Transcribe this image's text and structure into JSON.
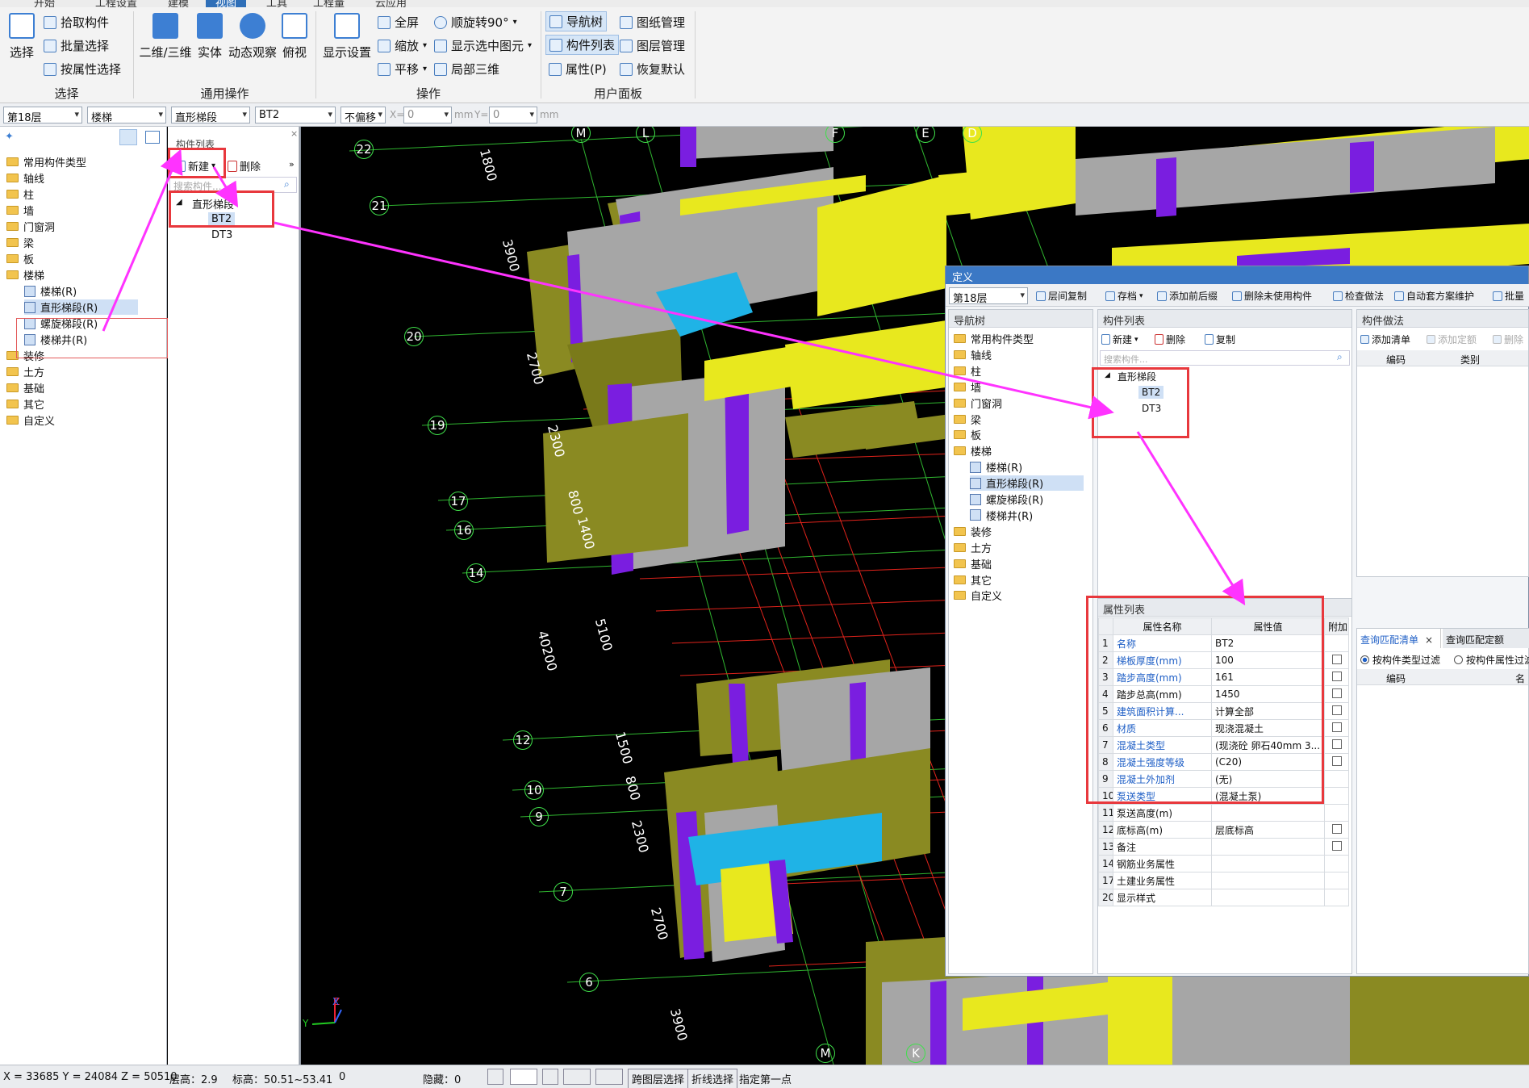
{
  "ribbon": {
    "tabs": [
      "开始",
      "工程设置",
      "建模",
      "视图",
      "工具",
      "工程量",
      "云应用"
    ],
    "active_tab": "视图",
    "select_group": {
      "big": "选择",
      "items": [
        "拾取构件",
        "批量选择",
        "按属性选择"
      ],
      "label": "选择"
    },
    "general_group": {
      "items": [
        "二维/三维",
        "实体",
        "动态观察",
        "俯视"
      ],
      "label": "通用操作"
    },
    "ops_group": {
      "display": "显示设置",
      "items": [
        "全屏",
        "缩放",
        "平移",
        "顺旋转90°",
        "显示选中图元",
        "局部三维"
      ],
      "label": "操作"
    },
    "panel_group": {
      "items": [
        "导航树",
        "构件列表",
        "属性(P)",
        "图纸管理",
        "图层管理",
        "恢复默认"
      ],
      "label": "用户面板"
    }
  },
  "toolbar": {
    "floor": "第18层",
    "category": "楼梯",
    "type": "直形梯段",
    "component": "BT2",
    "offset": "不偏移",
    "x_label": "X=",
    "x_value": "0",
    "y_label": "Y=",
    "y_value": "0",
    "unit": "mm"
  },
  "nav_tree": {
    "items": [
      "常用构件类型",
      "轴线",
      "柱",
      "墙",
      "门窗洞",
      "梁",
      "板",
      "楼梯",
      "楼梯(R)",
      "直形梯段(R)",
      "螺旋梯段(R)",
      "楼梯井(R)",
      "装修",
      "土方",
      "基础",
      "其它",
      "自定义"
    ]
  },
  "comp_list": {
    "title": "构件列表",
    "new": "新建",
    "delete": "删除",
    "search_placeholder": "搜索构件...",
    "group": "直形梯段",
    "items": [
      "BT2",
      "DT3"
    ]
  },
  "viewport": {
    "axis_top": [
      "M",
      "L",
      "F",
      "E",
      "D"
    ],
    "axis_bottom": [
      "M",
      "K"
    ],
    "rows": [
      "22",
      "21",
      "20",
      "19",
      "17",
      "16",
      "14",
      "12",
      "10",
      "9",
      "7",
      "6"
    ],
    "dims": [
      "1800",
      "3900",
      "2700",
      "2300",
      "800",
      "1400",
      "40200",
      "5100",
      "1500",
      "800",
      "2300",
      "2700",
      "3900"
    ]
  },
  "dialog": {
    "title": "定义",
    "floor": "第18层",
    "toolbar": [
      "层间复制",
      "存档",
      "添加前后缀",
      "删除未使用构件",
      "检查做法",
      "自动套方案维护",
      "批量"
    ],
    "nav_title": "导航树",
    "list_title": "构件列表",
    "list_new": "新建",
    "list_delete": "删除",
    "list_copy": "复制",
    "list_search": "搜索构件...",
    "list_group": "直形梯段",
    "list_items": [
      "BT2",
      "DT3"
    ],
    "method_title": "构件做法",
    "method_buttons": [
      "添加清单",
      "添加定额",
      "删除"
    ],
    "method_cols": [
      "编码",
      "类别"
    ],
    "props_title": "属性列表",
    "props_cols": [
      "属性名称",
      "属性值",
      "附加"
    ],
    "props": [
      {
        "n": "1",
        "name": "名称",
        "value": "BT2",
        "blue": true,
        "cb": false
      },
      {
        "n": "2",
        "name": "梯板厚度(mm)",
        "value": "100",
        "blue": true,
        "cb": true
      },
      {
        "n": "3",
        "name": "踏步高度(mm)",
        "value": "161",
        "blue": true,
        "cb": true
      },
      {
        "n": "4",
        "name": "踏步总高(mm)",
        "value": "1450",
        "blue": false,
        "cb": true
      },
      {
        "n": "5",
        "name": "建筑面积计算...",
        "value": "计算全部",
        "blue": true,
        "cb": true
      },
      {
        "n": "6",
        "name": "材质",
        "value": "现浇混凝土",
        "blue": true,
        "cb": true
      },
      {
        "n": "7",
        "name": "混凝土类型",
        "value": "(现浇砼 卵石40mm 3...",
        "blue": true,
        "cb": true
      },
      {
        "n": "8",
        "name": "混凝土强度等级",
        "value": "(C20)",
        "blue": true,
        "cb": true
      },
      {
        "n": "9",
        "name": "混凝土外加剂",
        "value": "(无)",
        "blue": true,
        "cb": false
      },
      {
        "n": "10",
        "name": "泵送类型",
        "value": "(混凝土泵)",
        "blue": true,
        "cb": false
      },
      {
        "n": "11",
        "name": "泵送高度(m)",
        "value": "",
        "blue": false,
        "cb": false
      },
      {
        "n": "12",
        "name": "底标高(m)",
        "value": "层底标高",
        "blue": false,
        "cb": true
      },
      {
        "n": "13",
        "name": "备注",
        "value": "",
        "blue": false,
        "cb": true
      },
      {
        "n": "14",
        "name": "钢筋业务属性",
        "value": "",
        "blue": false,
        "cb": false
      },
      {
        "n": "17",
        "name": "土建业务属性",
        "value": "",
        "blue": false,
        "cb": false
      },
      {
        "n": "20",
        "name": "显示样式",
        "value": "",
        "blue": false,
        "cb": false
      }
    ],
    "query_tabs": [
      "查询匹配清单",
      "查询匹配定额"
    ],
    "query_radio": [
      "按构件类型过滤",
      "按构件属性过滤"
    ],
    "query_cols": [
      "编码",
      "名"
    ]
  },
  "status": {
    "coords": "X = 33685 Y = 24084 Z = 50510",
    "floor_h": "层高：2.9",
    "elev": "标高：50.51~53.41",
    "zero": "0",
    "hidden": "隐藏：0",
    "cross_layer": "跨图层选择",
    "polyline": "折线选择",
    "prompt": "指定第一点"
  },
  "colors": {
    "accent": "#2f6fb8",
    "red_mark": "#e8383d",
    "arrow": "#ff33ff",
    "grid_green": "#2fb52f",
    "grid_red": "#e0231b",
    "wall_yellow": "#e8e81e",
    "wall_purple": "#7a1ee0",
    "wall_gray": "#a6a6a6",
    "stair_cyan": "#1fb3e6"
  }
}
